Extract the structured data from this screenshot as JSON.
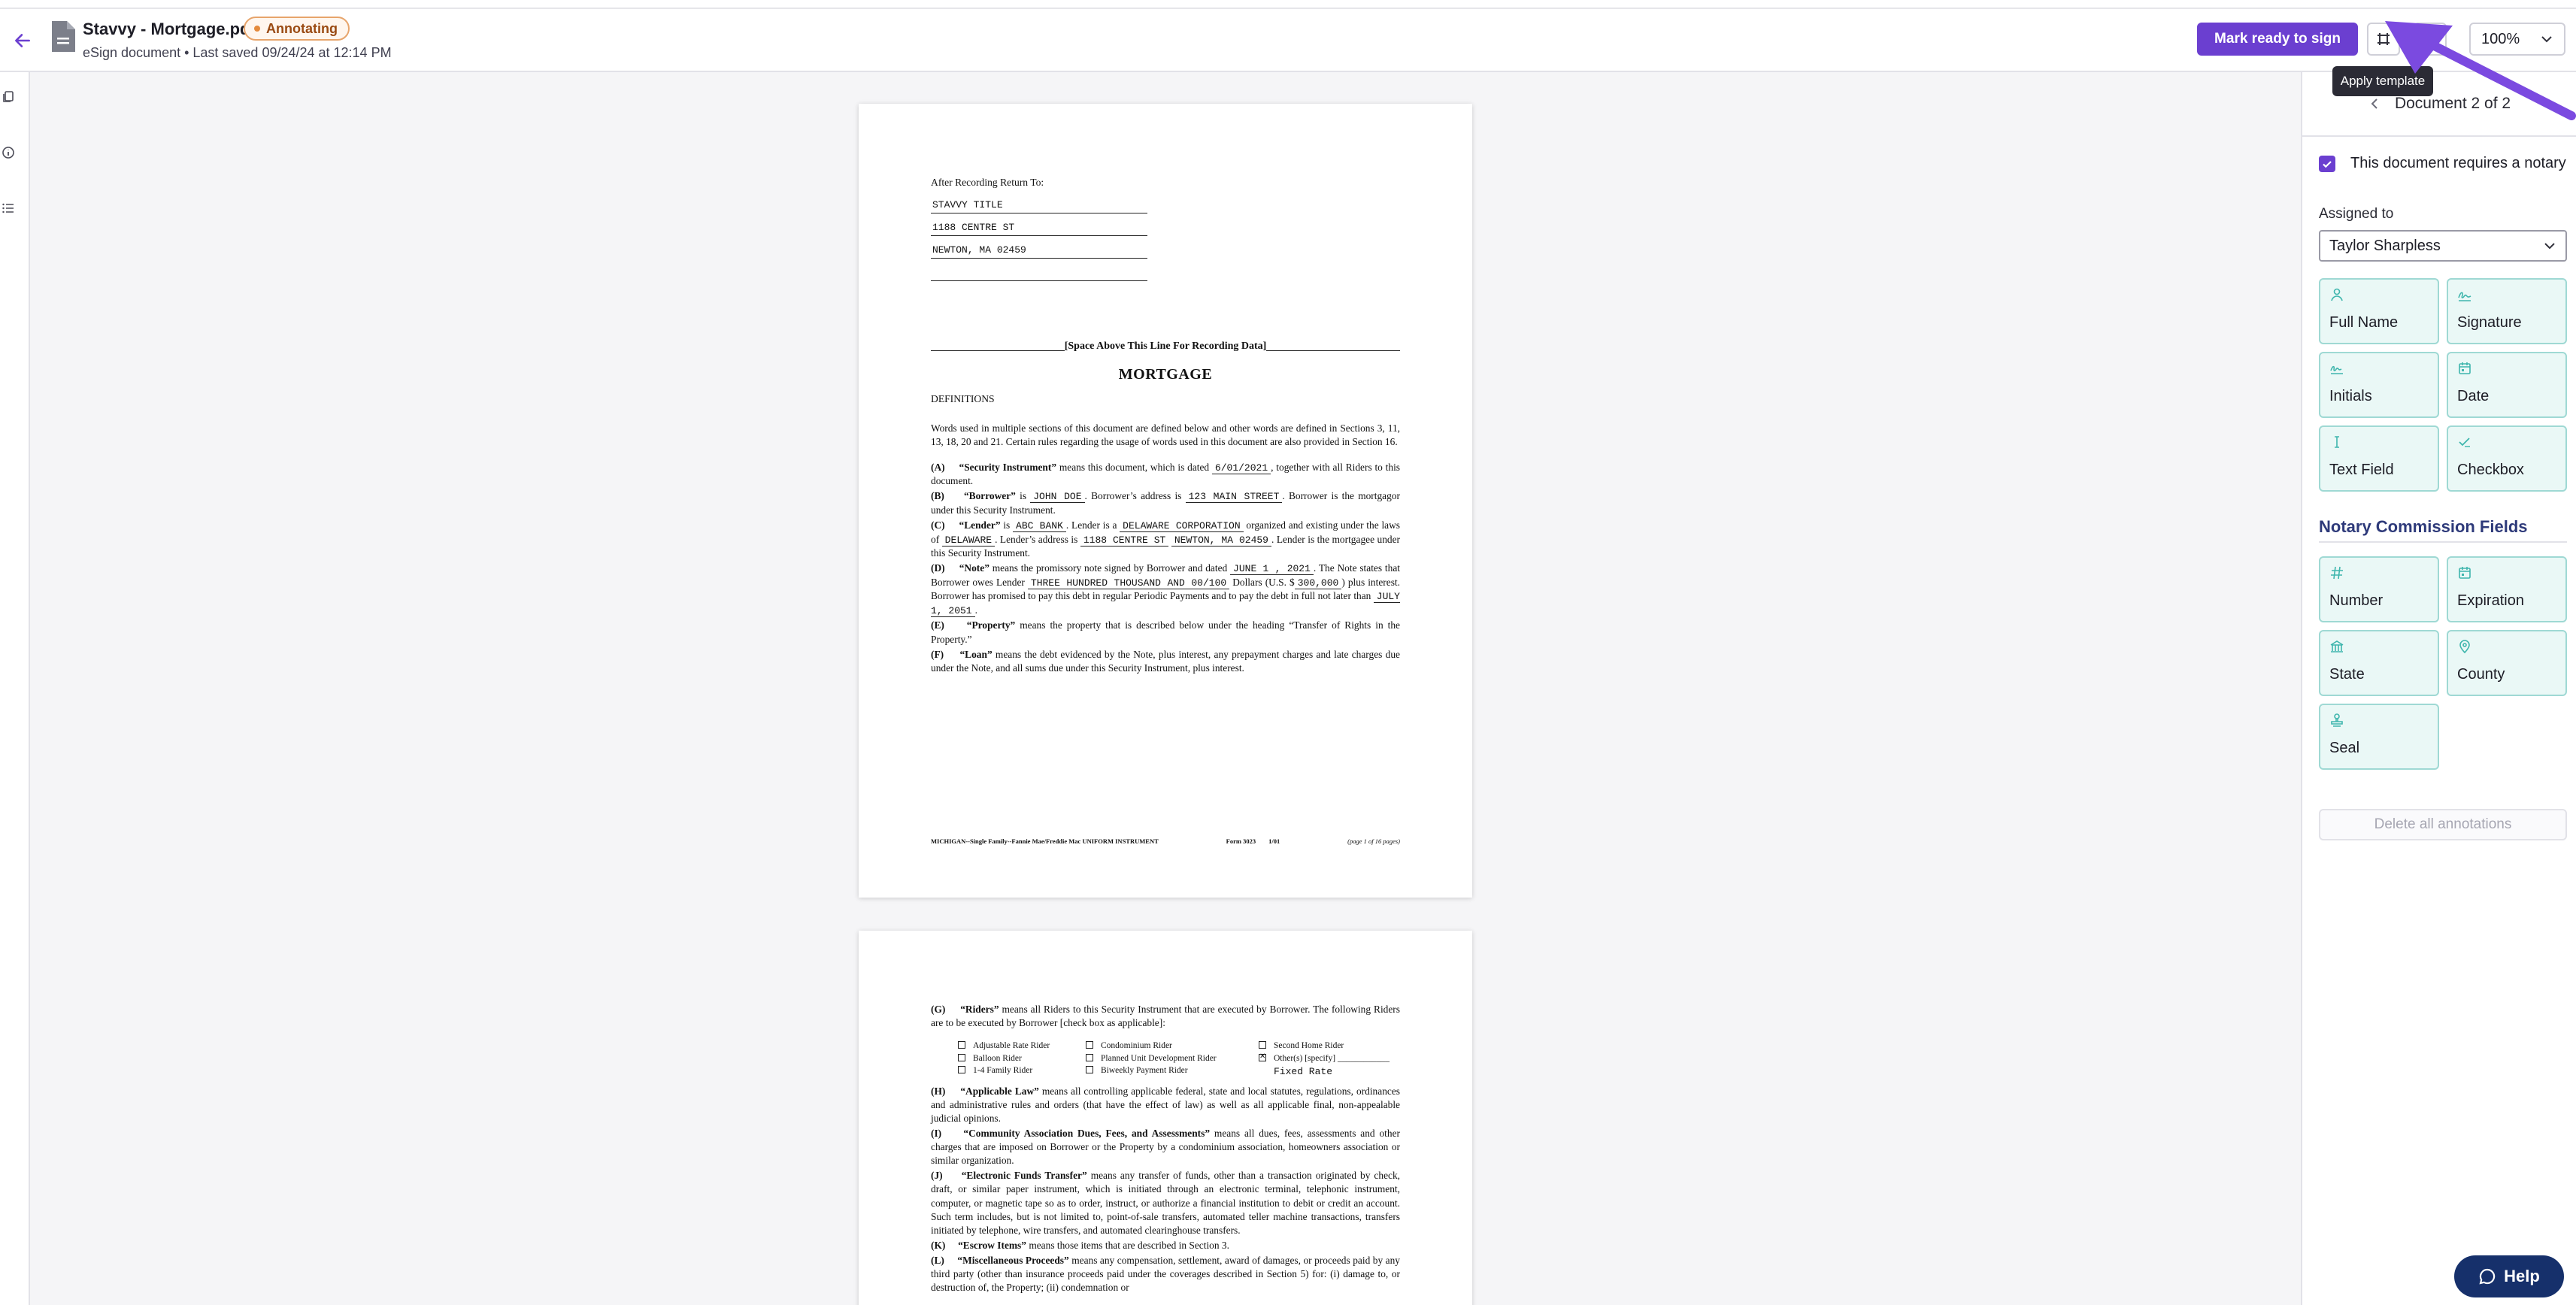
{
  "header": {
    "title": "Stavvy - Mortgage.pdf",
    "status": "Annotating",
    "subtitle": "eSign document • Last saved 09/24/24 at 12:14 PM",
    "primary_button": "Mark ready to sign",
    "zoom": "100%",
    "tooltip": "Apply template",
    "icons": [
      "back-arrow-icon",
      "document-icon",
      "template-icon",
      "add-icon",
      "chevron-down-icon"
    ]
  },
  "left_rail": {
    "icons": [
      "pages-icon",
      "info-icon",
      "list-icon"
    ]
  },
  "document": {
    "page1": {
      "return_to": "After Recording Return To:",
      "return_lines": [
        "STAVVY TITLE",
        "1188 CENTRE ST",
        "NEWTON, MA 02459",
        ""
      ],
      "space_line": "[Space Above This Line For Recording Data]",
      "title": "MORTGAGE",
      "definitions_heading": "DEFINITIONS",
      "intro": "Words used in multiple sections of this document are defined below and other words are defined in Sections 3, 11, 13, 18, 20 and 21.  Certain rules regarding the usage of words used in this document are also provided in Section 16.",
      "a_label": "(A)",
      "a_term": "“Security Instrument”",
      "a_text1": " means this document, which is dated ",
      "a_date": "6/01/2021",
      "a_text2": ", together with all Riders to this document.",
      "b_label": "(B)",
      "b_term": "“Borrower”",
      "b_text1": " is ",
      "b_name": "JOHN DOE",
      "b_text2": " Borrower’s address is ",
      "b_address": "123 MAIN STREET",
      "b_text3": ". Borrower is the mortgagor under this Security Instrument.",
      "c_label": "(C)",
      "c_term": "“Lender”",
      "c_text1": " is ",
      "c_name": "ABC BANK",
      "c_text2": " Lender is a ",
      "c_entity": "DELAWARE CORPORATION",
      "c_text3": " organized and existing under the laws of ",
      "c_state": "DELAWARE",
      "c_text4": ". Lender’s address is ",
      "c_address1": "1188 CENTRE ST",
      "c_address2": "NEWTON, MA 02459",
      "c_text5": ". Lender is the mortgagee under this Security Instrument.",
      "d_label": "(D)",
      "d_term": "“Note”",
      "d_text1": " means the promissory note signed by Borrower and dated ",
      "d_date": "JUNE 1 ,   2021",
      "d_text2": ". The Note states that Borrower owes Lender ",
      "d_amount_words": "THREE HUNDRED THOUSAND AND 00/100",
      "d_text3": " Dollars (U.S. $",
      "d_amount": "300,000",
      "d_text4": ") plus interest. Borrower has promised to pay this debt in regular Periodic Payments and to pay the debt in full not later than ",
      "d_maturity": "JULY 1, 2051",
      "d_text5": ".",
      "e_label": "(E)",
      "e_term": "“Property”",
      "e_text": " means the property that is described below under the heading “Transfer of Rights in the Property.”",
      "f_label": "(F)",
      "f_term": "“Loan”",
      "f_text": " means the debt evidenced by the Note, plus interest, any prepayment charges and late charges due under the Note, and all sums due under this Security Instrument, plus interest.",
      "footer_left": "MICHIGAN--Single Family--Fannie Mae/Freddie Mac UNIFORM INSTRUMENT",
      "footer_form": "Form 3023",
      "footer_date": "1/01",
      "footer_page": "(page 1 of 16 pages)"
    },
    "page2": {
      "g_label": "(G)",
      "g_term": "“Riders”",
      "g_text": " means all Riders to this Security Instrument that are executed by Borrower. The following Riders are to be executed by Borrower [check box as applicable]:",
      "riders": [
        {
          "label": "Adjustable Rate Rider",
          "checked": false
        },
        {
          "label": "Condominium Rider",
          "checked": false
        },
        {
          "label": "Second Home Rider",
          "checked": false
        },
        {
          "label": "Balloon Rider",
          "checked": false
        },
        {
          "label": "Planned Unit Development Rider",
          "checked": false
        },
        {
          "label": "Other(s) [specify]",
          "checked": true
        },
        {
          "label": "1-4 Family Rider",
          "checked": false
        },
        {
          "label": "Biweekly Payment Rider",
          "checked": false
        }
      ],
      "other_value": "Fixed Rate",
      "h_label": "(H)",
      "h_term": "“Applicable Law”",
      "h_text": " means all controlling applicable federal, state and local statutes, regulations, ordinances and administrative rules and orders (that have the effect of law) as well as all applicable final, non-appealable judicial opinions.",
      "i_label": "(I)",
      "i_term": "“Community Association Dues, Fees, and Assessments”",
      "i_text": " means all dues, fees, assessments and other charges that are imposed on Borrower or the Property by a condominium association, homeowners association or similar organization.",
      "j_label": "(J)",
      "j_term": "“Electronic Funds Transfer”",
      "j_text": " means any transfer of funds, other than a transaction originated by check, draft, or similar paper instrument, which is initiated through an electronic terminal, telephonic instrument, computer, or magnetic tape so as to order, instruct, or authorize a financial institution to debit or credit an account.  Such term includes, but is not limited to, point-of-sale transfers, automated teller machine transactions, transfers initiated by telephone, wire transfers, and automated clearinghouse transfers.",
      "k_label": "(K)",
      "k_term": "“Escrow Items”",
      "k_text": " means those items that are described in Section 3.",
      "l_label": "(L)",
      "l_term": "“Miscellaneous Proceeds”",
      "l_text": " means any compensation, settlement, award of damages, or proceeds paid by any third party (other than insurance proceeds paid under the coverages described in Section 5) for: (i) damage to, or destruction of, the Property; (ii) condemnation or"
    }
  },
  "sidebar": {
    "doc_nav": "Document 2 of 2",
    "notary_label": "This document requires a notary",
    "notary_checked": true,
    "assigned_label": "Assigned to",
    "assigned_value": "Taylor Sharpless",
    "fields": [
      {
        "label": "Full Name",
        "icon": "person-icon"
      },
      {
        "label": "Signature",
        "icon": "signature-icon"
      },
      {
        "label": "Initials",
        "icon": "initials-icon"
      },
      {
        "label": "Date",
        "icon": "calendar-icon"
      },
      {
        "label": "Text Field",
        "icon": "text-cursor-icon"
      },
      {
        "label": "Checkbox",
        "icon": "check-icon"
      }
    ],
    "notary_section_title": "Notary Commission Fields",
    "notary_fields": [
      {
        "label": "Number",
        "icon": "hash-icon"
      },
      {
        "label": "Expiration",
        "icon": "calendar-icon"
      },
      {
        "label": "State",
        "icon": "building-icon"
      },
      {
        "label": "County",
        "icon": "location-pin-icon"
      },
      {
        "label": "Seal",
        "icon": "stamp-icon"
      }
    ],
    "delete_button": "Delete all annotations"
  },
  "help_button": "Help",
  "colors": {
    "accent": "#6b3fd0",
    "tile_bg": "#eaf8f6",
    "tile_border": "#9fd9d4",
    "status_orange": "#e48a3c",
    "help_bg": "#16306b",
    "section_title": "#2e3a7a"
  }
}
